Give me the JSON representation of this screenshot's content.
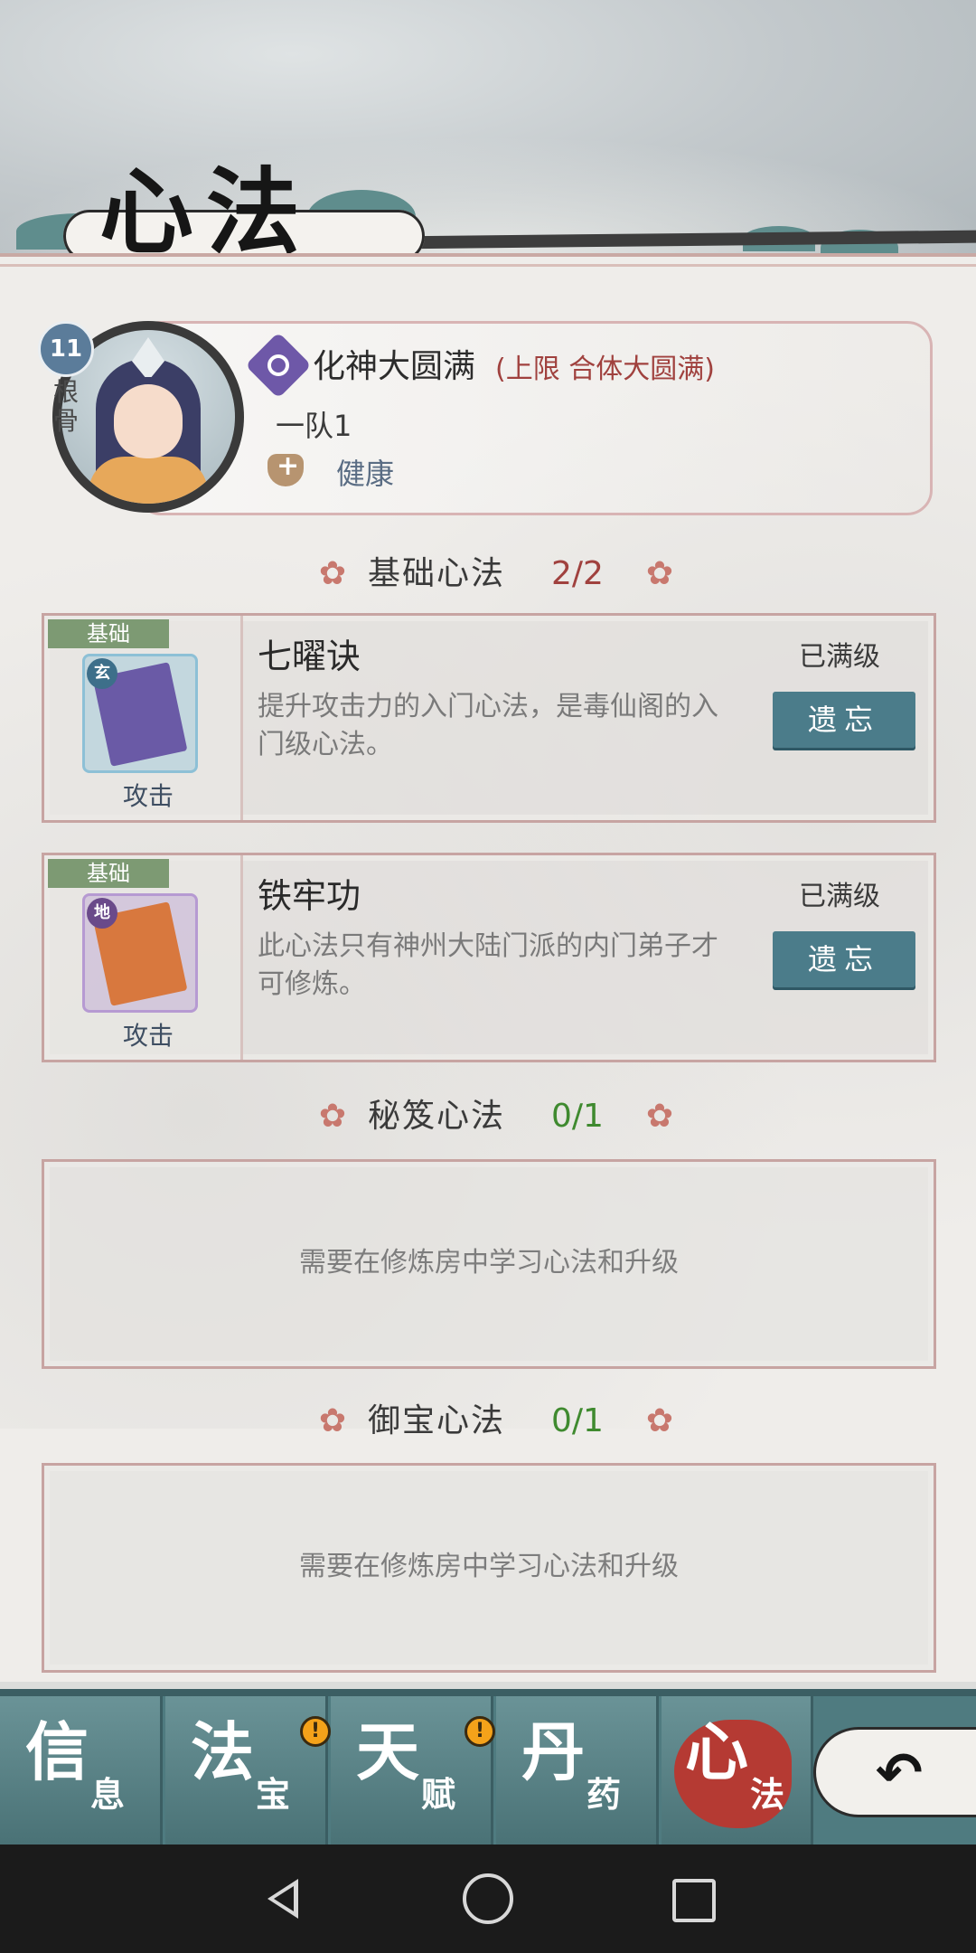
{
  "page": {
    "title": "心法"
  },
  "character": {
    "root_value": "11",
    "root_label": "根骨",
    "realm": "化神大圆满",
    "realm_limit": "(上限 合体大圆满)",
    "team": "一队1",
    "status": "健康"
  },
  "sections": [
    {
      "label": "基础心法",
      "count": "2/2",
      "count_color": "#a0413e",
      "techniques": [
        {
          "tag": "基础",
          "grade": "玄",
          "grade_color": "#3d6f8a",
          "cover_color": "#6a5aa6",
          "frame_color": "#8dc0d6",
          "type": "攻击",
          "name": "七曜诀",
          "description": "提升攻击力的入门心法，是毒仙阁的入门级心法。",
          "state": "已满级",
          "action": "遗忘"
        },
        {
          "tag": "基础",
          "grade": "地",
          "grade_color": "#6a4a8a",
          "cover_color": "#d8783e",
          "frame_color": "#b69ad2",
          "type": "攻击",
          "name": "铁牢功",
          "description": "此心法只有神州大陆门派的内门弟子才可修炼。",
          "state": "已满级",
          "action": "遗忘"
        }
      ]
    },
    {
      "label": "秘笈心法",
      "count": "0/1",
      "count_color": "#3f8a2f",
      "empty_text": "需要在修炼房中学习心法和升级"
    },
    {
      "label": "御宝心法",
      "count": "0/1",
      "count_color": "#3f8a2f",
      "empty_text": "需要在修炼房中学习心法和升级"
    }
  ],
  "nav": [
    {
      "big": "信",
      "small": "息",
      "alert": false
    },
    {
      "big": "法",
      "small": "宝",
      "alert": true
    },
    {
      "big": "天",
      "small": "赋",
      "alert": true
    },
    {
      "big": "丹",
      "small": "药",
      "alert": false
    },
    {
      "big": "心",
      "small": "法",
      "alert": false,
      "active": true
    }
  ],
  "alert_symbol": "!",
  "flower_symbol": "✿",
  "back_symbol": "↶",
  "colors": {
    "accent": "#4b7c8a",
    "active_tab": "#b53a33",
    "card_border": "#c7a4a2"
  }
}
